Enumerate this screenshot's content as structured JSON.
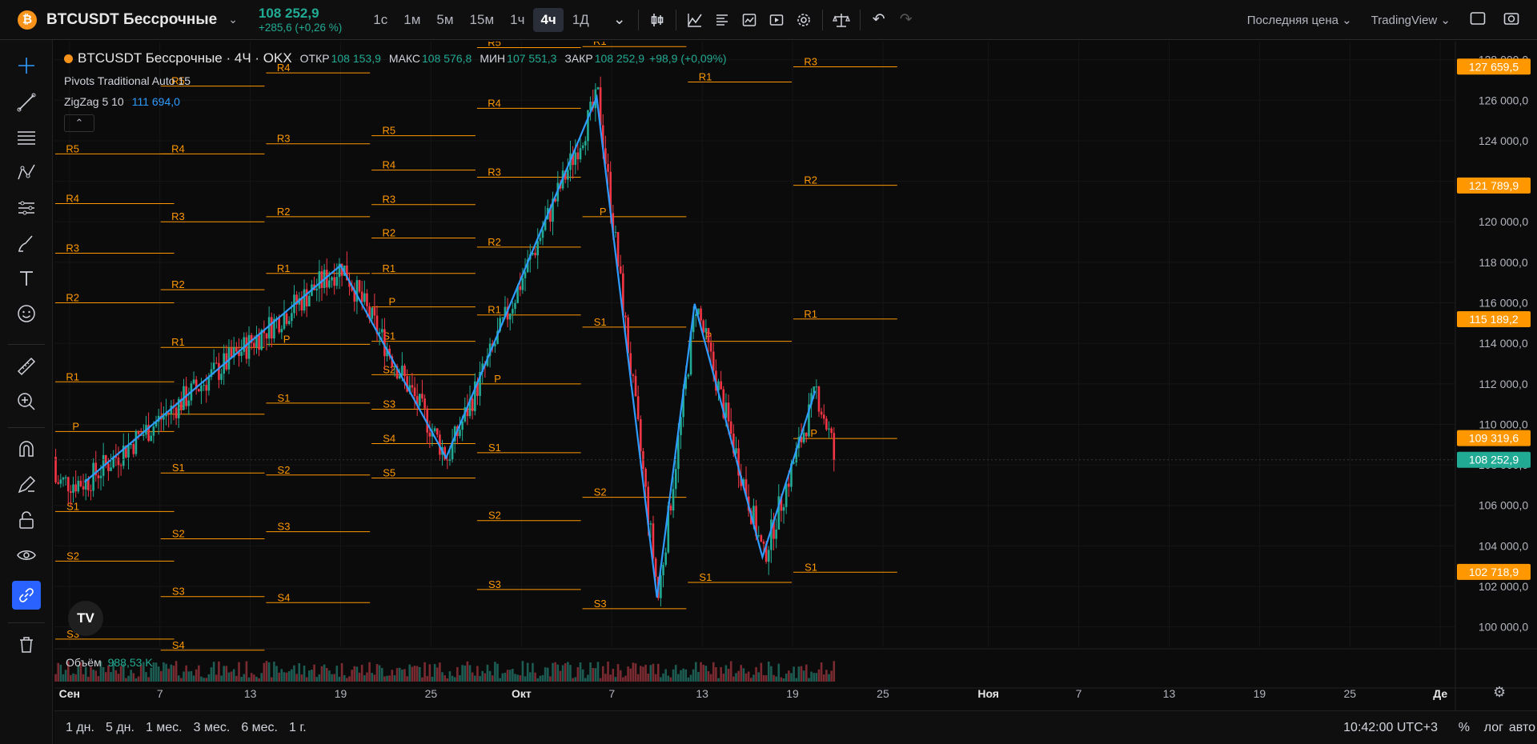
{
  "header": {
    "coin_icon": "₿",
    "symbol": "BTCUSDT Бессрочные",
    "last_price": "108 252,9",
    "change": "+285,6 (+0,26 %)",
    "timeframes": [
      "1с",
      "1м",
      "5м",
      "15м",
      "1ч",
      "4ч",
      "1Д"
    ],
    "active_timeframe": "4ч",
    "price_type": "Последняя цена",
    "provider": "TradingView"
  },
  "legend": {
    "title": "BTCUSDT Бессрочные · 4Ч · OKX",
    "open_label": "ОТКР",
    "open": "108 153,9",
    "high_label": "МАКС",
    "high": "108 576,8",
    "low_label": "МИН",
    "low": "107 551,3",
    "close_label": "ЗАКР",
    "close": "108 252,9",
    "diff": "+98,9 (+0,09%)",
    "pivots_indicator": "Pivots Traditional Auto 15",
    "zigzag_indicator": "ZigZag 5 10",
    "zigzag_value": "111 694,0",
    "collapse_icon": "chevron-up-icon"
  },
  "volume": {
    "label": "Объём",
    "value": "988,53 K"
  },
  "colors": {
    "up": "#22ab94",
    "down": "#f23645",
    "pivot": "#ff9800",
    "zigzag": "#2f9bff",
    "last_price_bg": "#22ab94",
    "pivot_label_bg": "#ff9800"
  },
  "chart_data": {
    "type": "candlestick",
    "ylim": [
      99000,
      128500
    ],
    "y_ticks": [
      "100 000,0",
      "102 000,0",
      "104 000,0",
      "106 000,0",
      "108 000,0",
      "110 000,0",
      "112 000,0",
      "114 000,0",
      "116 000,0",
      "118 000,0",
      "120 000,0",
      "122 000,0",
      "124 000,0",
      "126 000,0",
      "128 000,0"
    ],
    "y_tick_values": [
      100000,
      102000,
      104000,
      106000,
      108000,
      110000,
      112000,
      114000,
      116000,
      118000,
      120000,
      122000,
      124000,
      126000,
      128000
    ],
    "x_ticks": [
      "Сен",
      "7",
      "13",
      "19",
      "25",
      "Окт",
      "7",
      "13",
      "19",
      "25",
      "Ноя",
      "7",
      "13",
      "19",
      "25",
      "Де"
    ],
    "x_tick_days": [
      1,
      7,
      13,
      19,
      25,
      31,
      37,
      43,
      49,
      55,
      62,
      68,
      74,
      80,
      86,
      92
    ],
    "x_start_day": 0,
    "x_end_day": 93,
    "price_labels": [
      {
        "text": "127 659,5",
        "value": 127659.5,
        "kind": "pivot"
      },
      {
        "text": "121 789,9",
        "value": 121789.9,
        "kind": "pivot"
      },
      {
        "text": "115 189,2",
        "value": 115189.2,
        "kind": "pivot"
      },
      {
        "text": "109 319,6",
        "value": 109319.6,
        "kind": "pivot"
      },
      {
        "text": "108 252,9",
        "value": 108252.9,
        "kind": "last"
      },
      {
        "text": "102 718,9",
        "value": 102718.9,
        "kind": "pivot"
      }
    ],
    "zigzag": [
      {
        "day": 2,
        "value": 107150
      },
      {
        "day": 19,
        "value": 117850
      },
      {
        "day": 26,
        "value": 108350
      },
      {
        "day": 36,
        "value": 126150
      },
      {
        "day": 40,
        "value": 101450
      },
      {
        "day": 42.5,
        "value": 115950
      },
      {
        "day": 47,
        "value": 103450
      },
      {
        "day": 50.5,
        "value": 111650
      }
    ],
    "pivots": [
      {
        "from": 0,
        "to": 8,
        "levels": [
          {
            "name": "R5",
            "value": 123350
          },
          {
            "name": "R4",
            "value": 120900
          },
          {
            "name": "R3",
            "value": 118450
          },
          {
            "name": "R2",
            "value": 116000
          },
          {
            "name": "R1",
            "value": 112100
          },
          {
            "name": "P",
            "value": 109650
          },
          {
            "name": "S1",
            "value": 105700
          },
          {
            "name": "S2",
            "value": 103250
          },
          {
            "name": "S3",
            "value": 99400
          }
        ]
      },
      {
        "from": 7,
        "to": 14,
        "levels": [
          {
            "name": "R5",
            "value": 126700
          },
          {
            "name": "R4",
            "value": 123350
          },
          {
            "name": "R3",
            "value": 120000
          },
          {
            "name": "R2",
            "value": 116650
          },
          {
            "name": "R1",
            "value": 113800
          },
          {
            "name": "P",
            "value": 110500
          },
          {
            "name": "S1",
            "value": 107600
          },
          {
            "name": "S2",
            "value": 104350
          },
          {
            "name": "S3",
            "value": 101500
          },
          {
            "name": "S4",
            "value": 98850
          }
        ]
      },
      {
        "from": 14,
        "to": 21,
        "levels": [
          {
            "name": "R4",
            "value": 127350
          },
          {
            "name": "R3",
            "value": 123850
          },
          {
            "name": "R2",
            "value": 120250
          },
          {
            "name": "R1",
            "value": 117450
          },
          {
            "name": "P",
            "value": 113950
          },
          {
            "name": "S1",
            "value": 111050
          },
          {
            "name": "S2",
            "value": 107500
          },
          {
            "name": "S3",
            "value": 104700
          },
          {
            "name": "S4",
            "value": 101200
          },
          {
            "name": "S5",
            "value": 98350
          }
        ]
      },
      {
        "from": 21,
        "to": 28,
        "levels": [
          {
            "name": "R5",
            "value": 124250
          },
          {
            "name": "R4",
            "value": 122550
          },
          {
            "name": "R3",
            "value": 120850
          },
          {
            "name": "R2",
            "value": 119200
          },
          {
            "name": "R1",
            "value": 117450
          },
          {
            "name": "P",
            "value": 115800
          },
          {
            "name": "S1",
            "value": 114100
          },
          {
            "name": "S2",
            "value": 112450
          },
          {
            "name": "S3",
            "value": 110750
          },
          {
            "name": "S4",
            "value": 109050
          },
          {
            "name": "S5",
            "value": 107350
          }
        ]
      },
      {
        "from": 28,
        "to": 35,
        "levels": [
          {
            "name": "R5",
            "value": 128600
          },
          {
            "name": "R4",
            "value": 125600
          },
          {
            "name": "R3",
            "value": 122200
          },
          {
            "name": "R2",
            "value": 118750
          },
          {
            "name": "R1",
            "value": 115400
          },
          {
            "name": "P",
            "value": 112000
          },
          {
            "name": "S1",
            "value": 108600
          },
          {
            "name": "S2",
            "value": 105250
          },
          {
            "name": "S3",
            "value": 101850
          },
          {
            "name": "S4",
            "value": 98400
          }
        ]
      },
      {
        "from": 35,
        "to": 42,
        "levels": [
          {
            "name": "R1",
            "value": 128650
          },
          {
            "name": "P",
            "value": 120250
          },
          {
            "name": "S1",
            "value": 114800
          },
          {
            "name": "S2",
            "value": 106400
          },
          {
            "name": "S3",
            "value": 100900
          }
        ]
      },
      {
        "from": 42,
        "to": 49,
        "levels": [
          {
            "name": "R1",
            "value": 126900
          },
          {
            "name": "P",
            "value": 114100
          },
          {
            "name": "S1",
            "value": 102200
          }
        ]
      },
      {
        "from": 49,
        "to": 56,
        "levels": [
          {
            "name": "R3",
            "value": 127650
          },
          {
            "name": "R2",
            "value": 121800
          },
          {
            "name": "R1",
            "value": 115200
          },
          {
            "name": "P",
            "value": 109300
          },
          {
            "name": "S1",
            "value": 102700
          }
        ]
      }
    ]
  },
  "bottom": {
    "ranges": [
      "1 дн.",
      "5 дн.",
      "1 мес.",
      "3 мес.",
      "6 мес.",
      "1 г."
    ],
    "clock": "10:42:00 UTC+3",
    "percent": "%",
    "log": "лог",
    "auto": "авто"
  }
}
